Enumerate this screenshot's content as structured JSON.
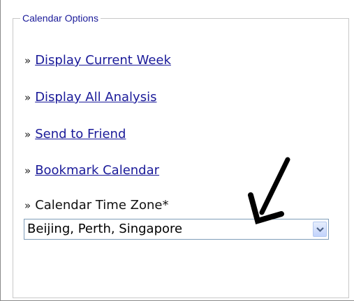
{
  "panel": {
    "legend": "Calendar Options",
    "bullet": "»",
    "links": [
      {
        "label": "Display Current Week"
      },
      {
        "label": "Display All Analysis"
      },
      {
        "label": "Send to Friend"
      },
      {
        "label": "Bookmark Calendar"
      }
    ],
    "timezone": {
      "label": "Calendar Time Zone*",
      "selected": "Beijing, Perth, Singapore"
    }
  },
  "colors": {
    "link": "#1a1a99",
    "legend": "#1a1a99",
    "border": "#8a8a8a",
    "select_border": "#7f9db9"
  },
  "icons": {
    "dropdown": "chevron-down-icon",
    "annotation": "arrow-annotation-icon"
  }
}
